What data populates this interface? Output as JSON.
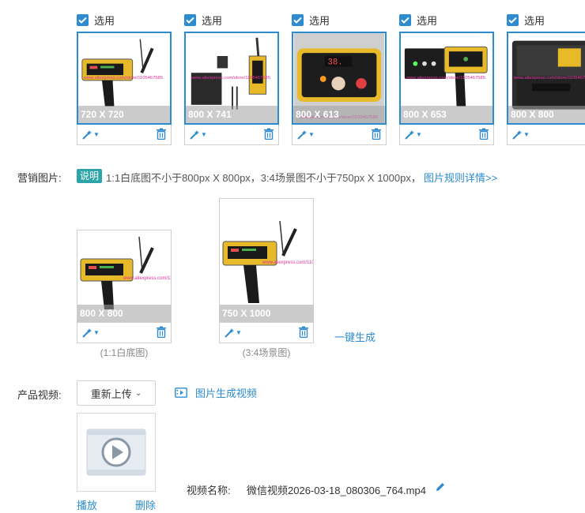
{
  "selection": {
    "check_label": "选用",
    "images": [
      {
        "dim": "720 X 720"
      },
      {
        "dim": "800 X 741"
      },
      {
        "dim": "800 X 613"
      },
      {
        "dim": "800 X 653"
      },
      {
        "dim": "800 X 800"
      }
    ]
  },
  "marketing": {
    "label": "营销图片:",
    "badge": "说明",
    "description": "1:1白底图不小于800px X 800px，3:4场景图不小于750px X 1000px，",
    "rules_link": "图片规则详情>>",
    "square": {
      "dim": "800 X 800",
      "caption": "(1:1白底图)"
    },
    "portrait": {
      "dim": "750 X 1000",
      "caption": "(3:4场景图)"
    },
    "generate_link": "一键生成"
  },
  "video": {
    "label": "产品视频:",
    "reupload_button": "重新上传",
    "generate_link": "图片生成视频",
    "play_link": "播放",
    "delete_link": "删除",
    "name_label": "视频名称:",
    "file_name": "微信视频2026-03-18_080306_764.mp4"
  },
  "watermark": "www.aliexpress.com/store/1105467585",
  "colors": {
    "accent": "#2d8ccf",
    "badge": "#2ca4a9"
  }
}
